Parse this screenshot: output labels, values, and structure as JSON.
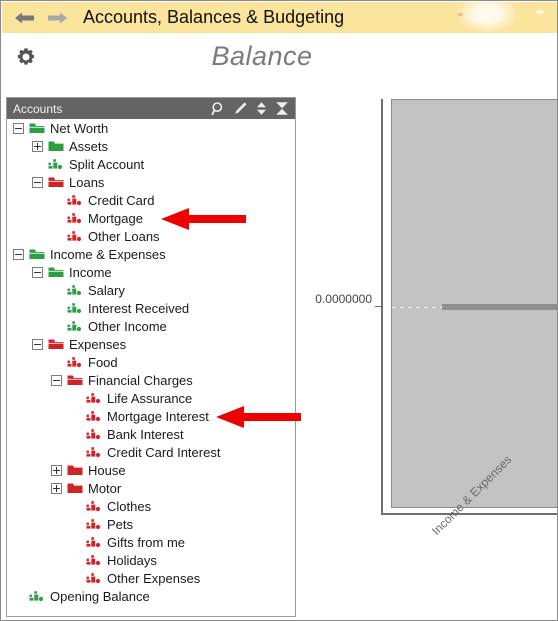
{
  "window": {
    "title": "Accounts, Balances & Budgeting",
    "back_icon": "arrow-left-icon",
    "forward_icon": "arrow-right-icon"
  },
  "header": {
    "settings_icon": "gear-icon",
    "page_title": "Balance"
  },
  "accounts_panel": {
    "header_label": "Accounts",
    "icons": [
      {
        "name": "search-icon",
        "glyph": "magnifier"
      },
      {
        "name": "edit-pencil-icon",
        "glyph": "pencil"
      },
      {
        "name": "sort-updown-icon",
        "glyph": "double-arrow"
      },
      {
        "name": "collapse-all-icon",
        "glyph": "hourglass"
      }
    ],
    "tree": [
      {
        "label": "Net Worth",
        "depth": 0,
        "expander": "minus",
        "icon": "folder-open",
        "color": "green"
      },
      {
        "label": "Assets",
        "depth": 1,
        "expander": "plus",
        "icon": "folder-closed",
        "color": "green"
      },
      {
        "label": "Split Account",
        "depth": 1,
        "expander": "none",
        "icon": "account",
        "color": "green"
      },
      {
        "label": "Loans",
        "depth": 1,
        "expander": "minus",
        "icon": "folder-open",
        "color": "red"
      },
      {
        "label": "Credit Card",
        "depth": 2,
        "expander": "none",
        "icon": "account",
        "color": "red"
      },
      {
        "label": "Mortgage",
        "depth": 2,
        "expander": "none",
        "icon": "account",
        "color": "red"
      },
      {
        "label": "Other Loans",
        "depth": 2,
        "expander": "none",
        "icon": "account",
        "color": "red"
      },
      {
        "label": "Income & Expenses",
        "depth": 0,
        "expander": "minus",
        "icon": "folder-open",
        "color": "green"
      },
      {
        "label": "Income",
        "depth": 1,
        "expander": "minus",
        "icon": "folder-open",
        "color": "green"
      },
      {
        "label": "Salary",
        "depth": 2,
        "expander": "none",
        "icon": "account",
        "color": "green"
      },
      {
        "label": "Interest Received",
        "depth": 2,
        "expander": "none",
        "icon": "account",
        "color": "green"
      },
      {
        "label": "Other Income",
        "depth": 2,
        "expander": "none",
        "icon": "account",
        "color": "green"
      },
      {
        "label": "Expenses",
        "depth": 1,
        "expander": "minus",
        "icon": "folder-open",
        "color": "red"
      },
      {
        "label": "Food",
        "depth": 2,
        "expander": "none",
        "icon": "account",
        "color": "red"
      },
      {
        "label": "Financial Charges",
        "depth": 2,
        "expander": "minus",
        "icon": "folder-open",
        "color": "red"
      },
      {
        "label": "Life Assurance",
        "depth": 3,
        "expander": "none",
        "icon": "account",
        "color": "red"
      },
      {
        "label": "Mortgage Interest",
        "depth": 3,
        "expander": "none",
        "icon": "account",
        "color": "red"
      },
      {
        "label": "Bank Interest",
        "depth": 3,
        "expander": "none",
        "icon": "account",
        "color": "red"
      },
      {
        "label": "Credit Card Interest",
        "depth": 3,
        "expander": "none",
        "icon": "account",
        "color": "red"
      },
      {
        "label": "House",
        "depth": 2,
        "expander": "plus",
        "icon": "folder-closed",
        "color": "red"
      },
      {
        "label": "Motor",
        "depth": 2,
        "expander": "plus",
        "icon": "folder-closed",
        "color": "red"
      },
      {
        "label": "Clothes",
        "depth": 3,
        "expander": "none",
        "icon": "account",
        "color": "red"
      },
      {
        "label": "Pets",
        "depth": 3,
        "expander": "none",
        "icon": "account",
        "color": "red"
      },
      {
        "label": "Gifts from me",
        "depth": 3,
        "expander": "none",
        "icon": "account",
        "color": "red"
      },
      {
        "label": "Holidays",
        "depth": 3,
        "expander": "none",
        "icon": "account",
        "color": "red"
      },
      {
        "label": "Other Expenses",
        "depth": 3,
        "expander": "none",
        "icon": "account",
        "color": "red"
      },
      {
        "label": "Opening Balance",
        "depth": 0,
        "expander": "none",
        "icon": "account",
        "color": "green"
      }
    ]
  },
  "annotations": [
    {
      "name": "arrow-pointing-to-mortgage",
      "points_to": "Mortgage",
      "color": "#ee0000"
    },
    {
      "name": "arrow-pointing-to-mortgage-interest",
      "points_to": "Mortgage Interest",
      "color": "#ee0000"
    }
  ],
  "colors": {
    "titlebar": "#fbe49b",
    "panel_header": "#646464",
    "tree_green": "#2e9e42",
    "tree_red": "#cf2326",
    "plot_background": "#c3c3c3",
    "bar": "#8f8f8f",
    "annotation_red": "#ee0000"
  },
  "chart_data": {
    "type": "bar",
    "title": "Balance",
    "xlabel": "",
    "ylabel": "",
    "categories": [
      "Income & Expenses"
    ],
    "values": [
      0
    ],
    "series": [
      {
        "name": "Balance",
        "values": [
          0
        ]
      }
    ],
    "ytick_labels": [
      "0.0000000"
    ],
    "ylim": [
      -1,
      1
    ],
    "grid": true,
    "legend": "none",
    "notes": "Single zero-valued bar rendered as a flat line at the 0.0000000 gridline; x tick label rotated 45 degrees."
  }
}
